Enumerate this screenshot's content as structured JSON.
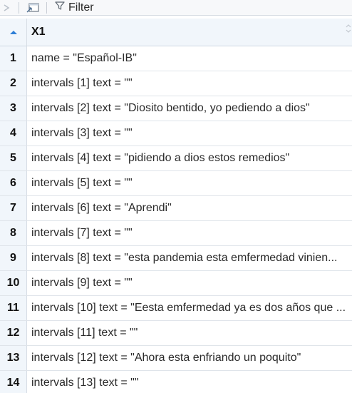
{
  "toolbar": {
    "filter_label": "Filter",
    "icons": [
      "forward-arrow-icon",
      "popout-window-icon",
      "filter-funnel-icon"
    ]
  },
  "grid": {
    "sort_icon": "sort-ascending-icon",
    "column_header": "X1",
    "rows": [
      {
        "index": "1",
        "value": "name = \"Español-IB\""
      },
      {
        "index": "2",
        "value": "intervals [1] text = \"\""
      },
      {
        "index": "3",
        "value": "intervals [2] text = \"Diosito bentido, yo pediendo a dios\""
      },
      {
        "index": "4",
        "value": "intervals [3] text = \"\""
      },
      {
        "index": "5",
        "value": "intervals [4] text = \"pidiendo a dios estos remedios\""
      },
      {
        "index": "6",
        "value": "intervals [5] text = \"\""
      },
      {
        "index": "7",
        "value": "intervals [6] text = \"Aprendi\""
      },
      {
        "index": "8",
        "value": "intervals [7] text = \"\""
      },
      {
        "index": "9",
        "value": "intervals [8] text = \"esta pandemia esta emfermedad vinien..."
      },
      {
        "index": "10",
        "value": "intervals [9] text = \"\""
      },
      {
        "index": "11",
        "value": "intervals [10] text = \"Eesta emfermedad ya es dos años que ..."
      },
      {
        "index": "12",
        "value": "intervals [11] text = \"\""
      },
      {
        "index": "13",
        "value": "intervals [12] text = \"Ahora esta enfriando un poquito\""
      },
      {
        "index": "14",
        "value": "intervals [13] text = \"\""
      }
    ]
  },
  "colors": {
    "header_bg": "#f1f6fb",
    "sort_arrow": "#2f7fd6",
    "grid_line": "#dfe4ea"
  }
}
